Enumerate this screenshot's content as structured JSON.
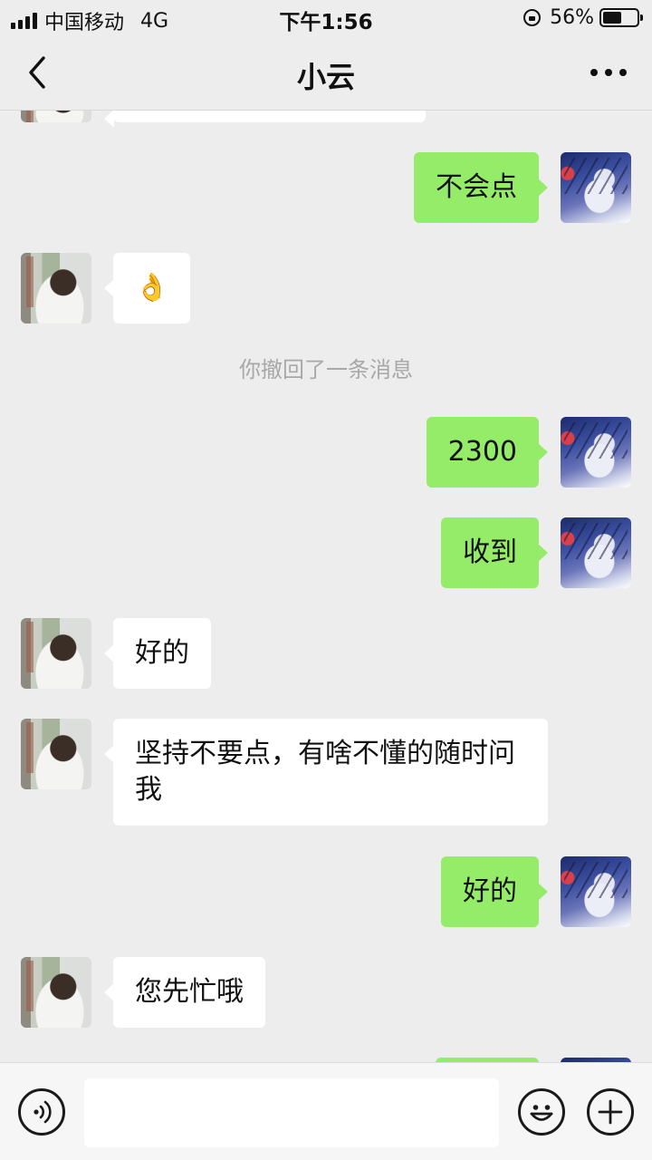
{
  "status_bar": {
    "carrier": "中国移动",
    "network": "4G",
    "time": "下午1:56",
    "battery_percent": "56%",
    "battery_level": 0.56
  },
  "header": {
    "title": "小云"
  },
  "messages": [
    {
      "type": "out",
      "text": "不会点"
    },
    {
      "type": "in",
      "text": "👌"
    },
    {
      "type": "notice",
      "text": "你撤回了一条消息"
    },
    {
      "type": "out",
      "text": "2300"
    },
    {
      "type": "out",
      "text": "收到"
    },
    {
      "type": "in",
      "text": "好的"
    },
    {
      "type": "in",
      "text": "坚持不要点，有啥不懂的随时问我"
    },
    {
      "type": "out",
      "text": "好的"
    },
    {
      "type": "in",
      "text": "您先忙哦"
    }
  ],
  "input": {
    "value": ""
  },
  "icons": {
    "back": "chevron-left-icon",
    "more": "more-dots-icon",
    "voice": "voice-icon",
    "emoji": "smiley-icon",
    "add": "plus-icon"
  },
  "colors": {
    "background": "#ededed",
    "outgoing_bubble": "#95ec69",
    "incoming_bubble": "#ffffff",
    "notice_text": "#a8a8a8"
  }
}
